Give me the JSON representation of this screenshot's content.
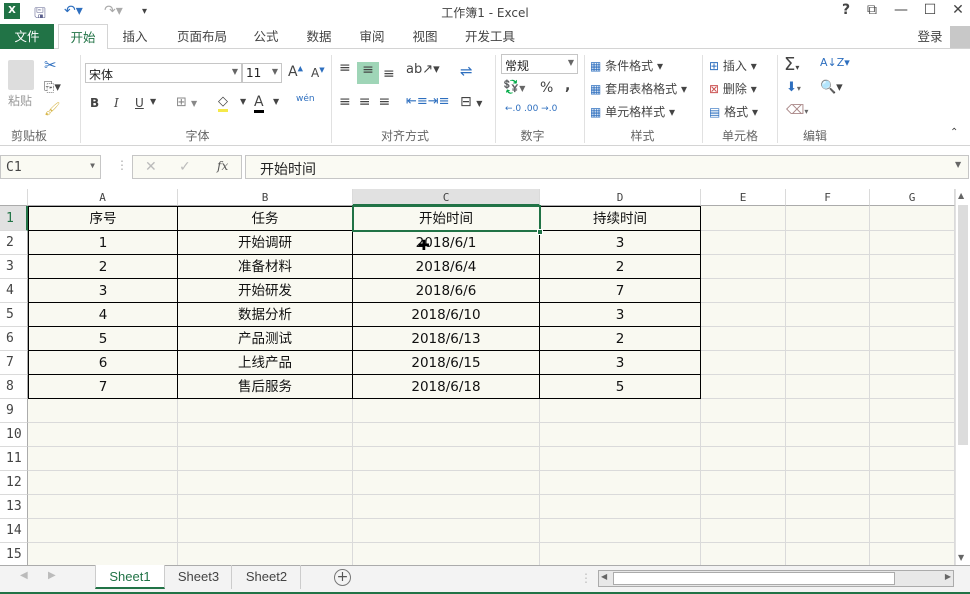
{
  "window": {
    "title": "工作簿1 - Excel",
    "help": "?",
    "login": "登录"
  },
  "ribbon_tabs": [
    "文件",
    "开始",
    "插入",
    "页面布局",
    "公式",
    "数据",
    "审阅",
    "视图",
    "开发工具"
  ],
  "ribbon": {
    "clipboard": {
      "paste": "粘贴",
      "label": "剪贴板"
    },
    "font": {
      "name": "宋体",
      "size": "11",
      "bold": "B",
      "italic": "I",
      "underline": "U",
      "phonetic": "wén",
      "label": "字体"
    },
    "alignment": {
      "label": "对齐方式"
    },
    "number": {
      "format": "常规",
      "percent": "%",
      "comma": ",",
      "label": "数字"
    },
    "styles": {
      "conditional": "条件格式",
      "table": "套用表格格式",
      "cell": "单元格样式",
      "label": "样式"
    },
    "cells": {
      "insert": "插入",
      "delete": "删除",
      "format": "格式",
      "label": "单元格"
    },
    "editing": {
      "label": "编辑"
    }
  },
  "formula_bar": {
    "name_box": "C1",
    "fx": "fx",
    "value": "开始时间"
  },
  "columns": [
    "A",
    "B",
    "C",
    "D",
    "E",
    "F",
    "G"
  ],
  "selected_column": "C",
  "selected_row": 1,
  "rows": [
    [
      "序号",
      "任务",
      "开始时间",
      "持续时间"
    ],
    [
      "1",
      "开始调研",
      "2018/6/1",
      "3"
    ],
    [
      "2",
      "准备材料",
      "2018/6/4",
      "2"
    ],
    [
      "3",
      "开始研发",
      "2018/6/6",
      "7"
    ],
    [
      "4",
      "数据分析",
      "2018/6/10",
      "3"
    ],
    [
      "5",
      "产品测试",
      "2018/6/13",
      "2"
    ],
    [
      "6",
      "上线产品",
      "2018/6/15",
      "3"
    ],
    [
      "7",
      "售后服务",
      "2018/6/18",
      "5"
    ]
  ],
  "row_numbers": [
    "1",
    "2",
    "3",
    "4",
    "5",
    "6",
    "7",
    "8",
    "9",
    "10",
    "11",
    "12",
    "13",
    "14",
    "15"
  ],
  "sheets": [
    {
      "name": "Sheet1",
      "active": true
    },
    {
      "name": "Sheet3",
      "active": false
    },
    {
      "name": "Sheet2",
      "active": false
    }
  ],
  "colors": {
    "accent": "#217346",
    "sheet_bg": "#f9f9f1"
  }
}
